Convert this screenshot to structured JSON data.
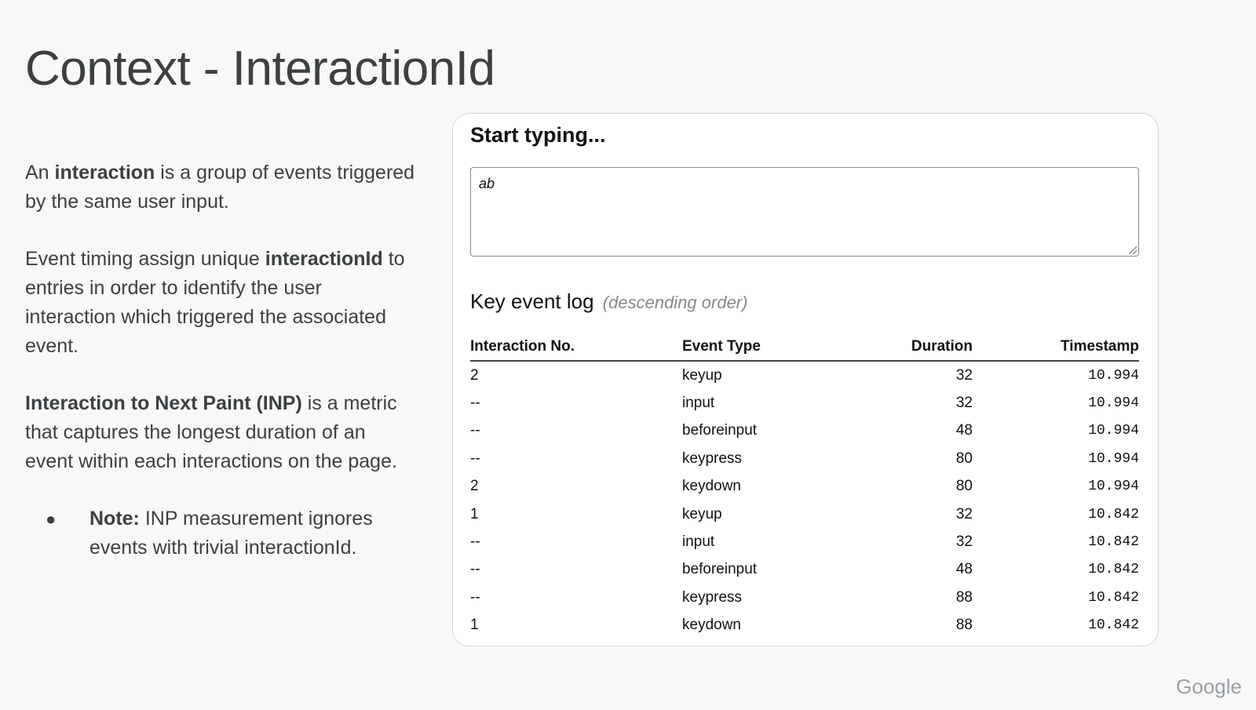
{
  "slide": {
    "title": "Context - InteractionId"
  },
  "left": {
    "p1": {
      "a": "An ",
      "b": "interaction",
      "c": " is a group of events triggered by the same user input."
    },
    "p2": {
      "a": "Event timing assign unique ",
      "b": "interactionId",
      "c": " to entries in order to identify the user interaction which triggered the associated event."
    },
    "p3": {
      "b": "Interaction to Next Paint (INP)",
      "c": " is a metric that captures the longest duration of an event within each interactions on the page."
    },
    "note": {
      "bullet": "●",
      "b": "Note:",
      "c": " INP measurement ignores events with trivial interactionId."
    }
  },
  "panel": {
    "heading": "Start typing...",
    "textarea_value": "ab",
    "log_title": "Key event log",
    "log_subtitle": "(descending order)",
    "columns": [
      "Interaction No.",
      "Event Type",
      "Duration",
      "Timestamp"
    ],
    "rows": [
      [
        "2",
        "keyup",
        "32",
        "10.994"
      ],
      [
        "--",
        "input",
        "32",
        "10.994"
      ],
      [
        "--",
        "beforeinput",
        "48",
        "10.994"
      ],
      [
        "--",
        "keypress",
        "80",
        "10.994"
      ],
      [
        "2",
        "keydown",
        "80",
        "10.994"
      ],
      [
        "1",
        "keyup",
        "32",
        "10.842"
      ],
      [
        "--",
        "input",
        "32",
        "10.842"
      ],
      [
        "--",
        "beforeinput",
        "48",
        "10.842"
      ],
      [
        "--",
        "keypress",
        "88",
        "10.842"
      ],
      [
        "1",
        "keydown",
        "88",
        "10.842"
      ]
    ]
  },
  "footer": {
    "logo": "Google"
  }
}
